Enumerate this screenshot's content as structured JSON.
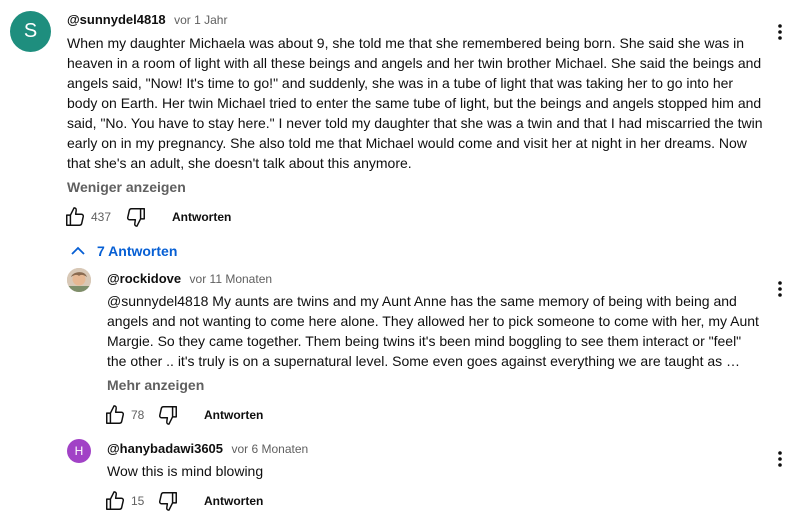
{
  "comment": {
    "avatar_letter": "S",
    "avatar_color": "#1e8e7e",
    "handle": "@sunnydel4818",
    "time": "vor 1 Jahr",
    "text": "When my daughter Michaela was about 9, she told me that she remembered being born. She said she was in\nheaven in a room of light with all these beings and angels and her twin brother Michael. She said the beings and\nangels said, \"Now! It's time to go!\" and suddenly, she was in a tube of light that was taking her to go into her\nbody on Earth. Her twin Michael tried to enter the same tube of light, but the beings and angels stopped him and\nsaid, \"No. You have to stay here.\" I never told my daughter that she was a twin and that I had miscarried the twin\nearly on in my pregnancy. She also told me that Michael would come and visit her at night in her dreams. Now\nthat she's an adult, she doesn't talk about this anymore.",
    "show_less": "Weniger anzeigen",
    "likes": "437",
    "reply_label": "Antworten"
  },
  "replies_toggle": "7 Antworten",
  "replies": [
    {
      "handle": "@rockidove",
      "time": "vor 11 Monaten",
      "text": "@sunnydel4818 My aunts are twins and my Aunt Anne has the same memory of being with being and\nangels and not wanting to come here alone. They allowed her to pick someone to come with her, my Aunt\nMargie. So they came together. Them being twins it's been mind boggling to see them interact or \"feel\"\nthe other .. it's truly is on a supernatural level. Some even goes against everything we are taught as …",
      "show_more": "Mehr anzeigen",
      "likes": "78",
      "reply_label": "Antworten"
    },
    {
      "avatar_letter": "H",
      "avatar_color": "#a142c6",
      "handle": "@hanybadawi3605",
      "time": "vor 6 Monaten",
      "text": "Wow this is mind blowing",
      "likes": "15",
      "reply_label": "Antworten"
    }
  ],
  "icons": [
    "like-icon",
    "dislike-icon",
    "more-vert-icon",
    "chevron-up-icon"
  ]
}
